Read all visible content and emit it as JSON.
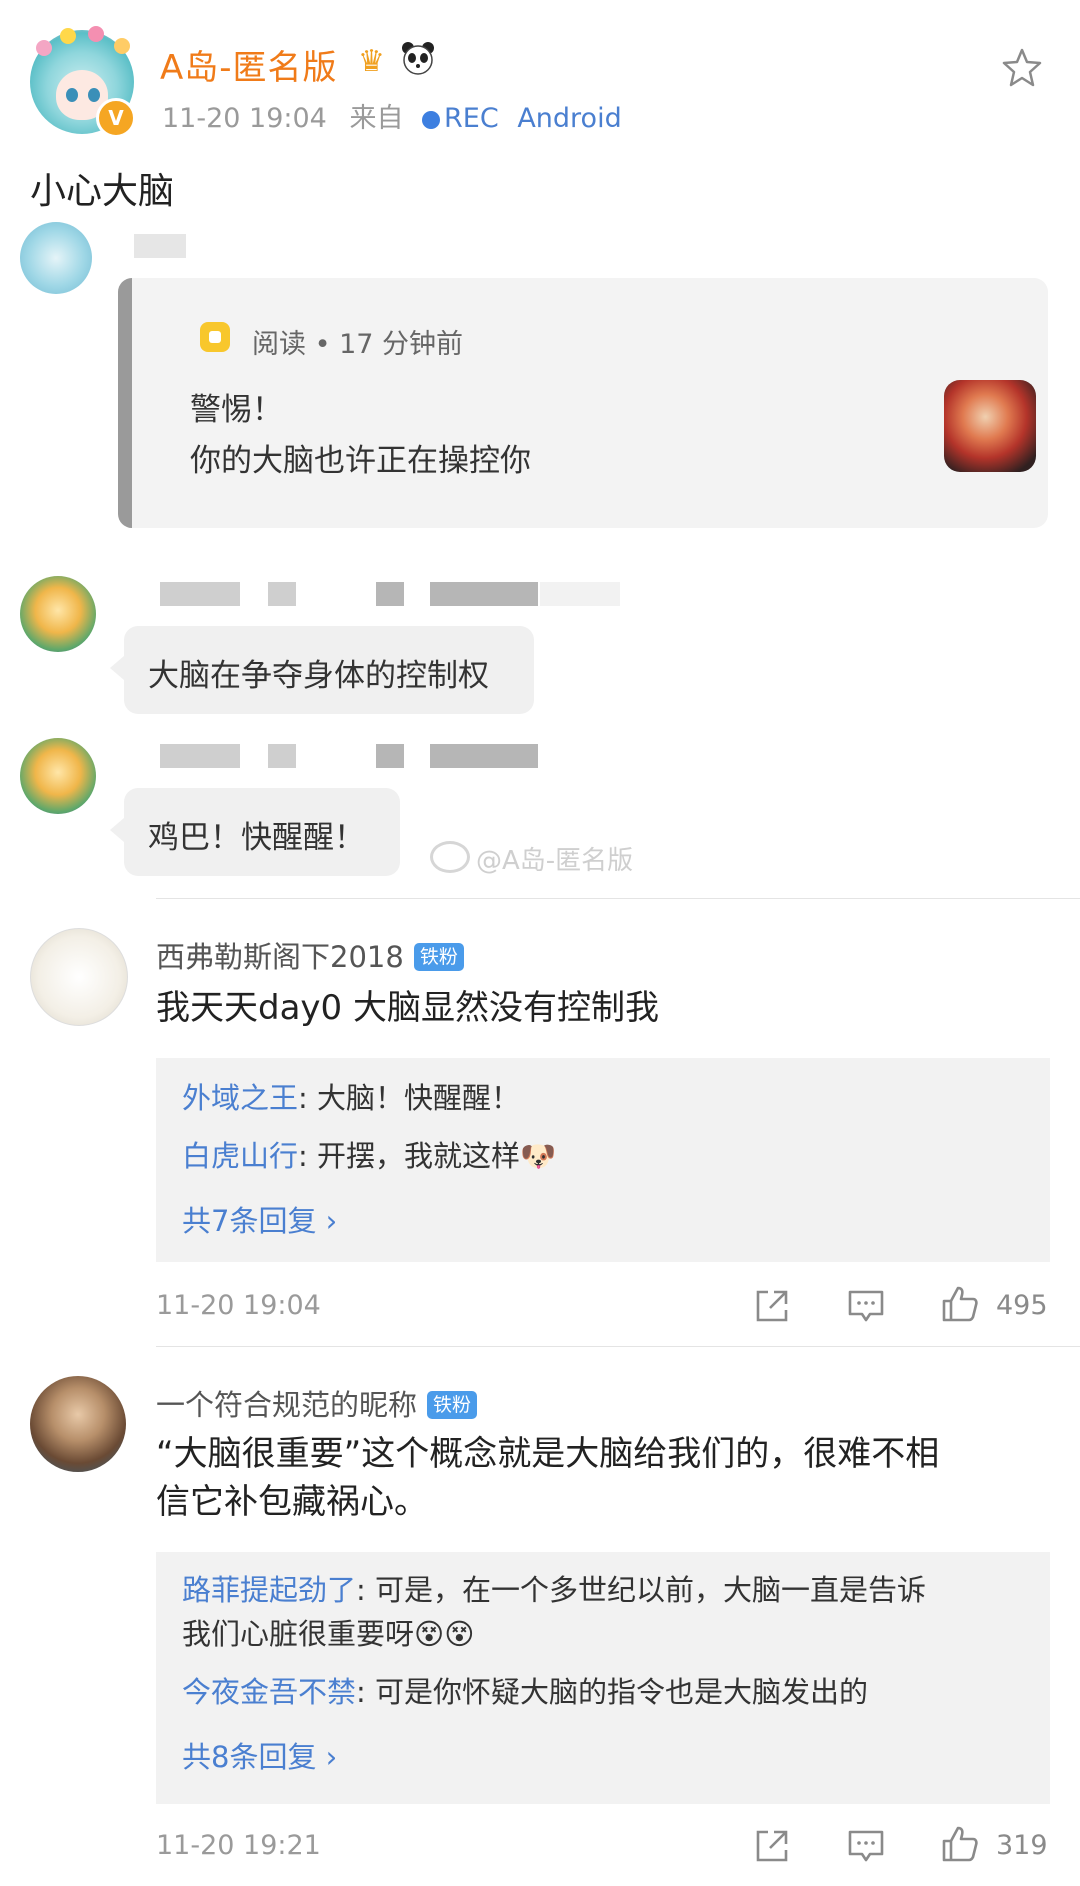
{
  "post": {
    "author": "A岛-匿名版",
    "verified_badge": "V",
    "crown_icon": "♛",
    "time": "11-20 19:04",
    "from_label": "来自",
    "source": "REC",
    "device": "Android",
    "text": "小心大脑"
  },
  "screenshot": {
    "card": {
      "meta": "阅读 • 17 分钟前",
      "line1": "警惕！",
      "line2": "你的大脑也许正在操控你"
    },
    "bubble1": "大脑在争夺身体的控制权",
    "bubble2": "鸡巴！快醒醒！",
    "watermark": "@A岛-匿名版"
  },
  "comments": [
    {
      "name": "西弗勒斯阁下2018",
      "badge": "铁粉",
      "text": "我天天day0 大脑显然没有控制我",
      "replies": [
        {
          "name": "外域之王",
          "text": ": 大脑！快醒醒！"
        },
        {
          "name": "白虎山行",
          "text": ": 开摆，我就这样🐶"
        }
      ],
      "more": "共7条回复 ›",
      "time": "11-20 19:04",
      "likes": "495"
    },
    {
      "name": "一个符合规范的昵称",
      "badge": "铁粉",
      "text_line1": "“大脑很重要”这个概念就是大脑给我们的，很难不相",
      "text_line2": "信它补包藏祸心。",
      "replies": [
        {
          "name": "路菲提起劲了",
          "text": ": 可是，在一个多世纪以前，大脑一直是告诉",
          "text2": "我们心脏很重要呀😵😵"
        },
        {
          "name": "今夜金吾不禁",
          "text": ": 可是你怀疑大脑的指令也是大脑发出的"
        }
      ],
      "more": "共8条回复 ›",
      "time": "11-20 19:21",
      "likes": "319"
    }
  ],
  "colors": {
    "accent_orange": "#f07b19",
    "link_blue": "#4a7fd0",
    "badge_blue": "#4a9bea"
  }
}
